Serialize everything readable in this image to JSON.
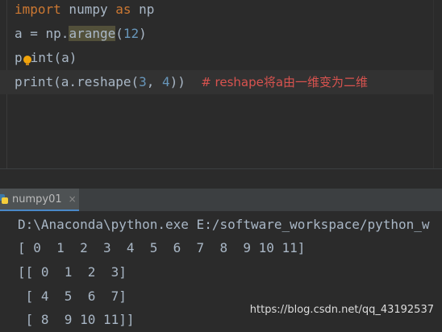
{
  "editor": {
    "line1": {
      "kw1": "import",
      "mid": " numpy ",
      "kw2": "as",
      "end": " np"
    },
    "line2": {
      "a": "a = np.",
      "method": "arange",
      "open": "(",
      "num": "12",
      "close": ")"
    },
    "line3": {
      "pre": "p",
      "rest": "int(a)"
    },
    "line4": {
      "fn": "print(a.reshape(",
      "n1": "3",
      "sep": ", ",
      "n2": "4",
      "close": "))",
      "comment": "# reshape将a由一维变为二维"
    }
  },
  "run_tab": {
    "label": "numpy01",
    "close": "×"
  },
  "console": {
    "cmd": "D:\\Anaconda\\python.exe E:/software_workspace/python_w",
    "out1": "[ 0  1  2  3  4  5  6  7  8  9 10 11]",
    "out2": "[[ 0  1  2  3]",
    "out3": " [ 4  5  6  7]",
    "out4": " [ 8  9 10 11]]"
  },
  "watermark": "https://blog.csdn.net/qq_43192537"
}
